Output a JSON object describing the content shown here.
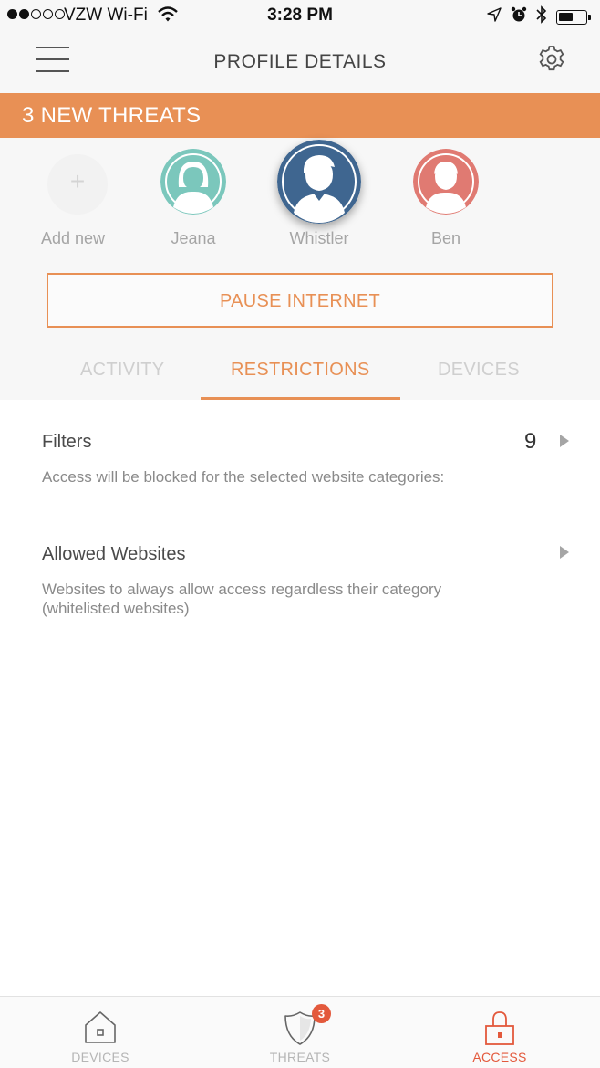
{
  "status_bar": {
    "carrier": "VZW Wi-Fi",
    "time": "3:28 PM",
    "signal_bars_filled": 2,
    "signal_bars_total": 5,
    "battery_level": 0.55
  },
  "header": {
    "title": "PROFILE DETAILS",
    "menu_icon": "hamburger-icon",
    "settings_icon": "gear-icon"
  },
  "banner": {
    "text": "3 NEW THREATS",
    "color": "#e89055"
  },
  "profiles": {
    "add_label": "Add new",
    "add_symbol": "+",
    "items": [
      {
        "name": "Jeana",
        "color": "#7bc7bc",
        "avatar": "female-avatar-icon",
        "selected": false
      },
      {
        "name": "Whistler",
        "color": "#3f6690",
        "avatar": "male-avatar-icon",
        "selected": true
      },
      {
        "name": "Ben",
        "color": "#e07a72",
        "avatar": "male-avatar-icon",
        "selected": false
      }
    ]
  },
  "pause_button": {
    "label": "PAUSE INTERNET"
  },
  "tabs": {
    "items": [
      "ACTIVITY",
      "RESTRICTIONS",
      "DEVICES"
    ],
    "active": "RESTRICTIONS"
  },
  "restrictions": [
    {
      "title": "Filters",
      "count": "9",
      "description": "Access will be blocked for the selected website categories:"
    },
    {
      "title": "Allowed Websites",
      "description_line1": "Websites to always allow access regardless their category",
      "description_line2": "(whitelisted websites)"
    }
  ],
  "bottom_nav": {
    "items": [
      {
        "label": "DEVICES",
        "icon": "house-icon"
      },
      {
        "label": "THREATS",
        "icon": "shield-icon",
        "badge": "3"
      },
      {
        "label": "ACCESS",
        "icon": "lock-icon"
      }
    ],
    "active": "ACCESS",
    "active_color": "#e3593c"
  }
}
